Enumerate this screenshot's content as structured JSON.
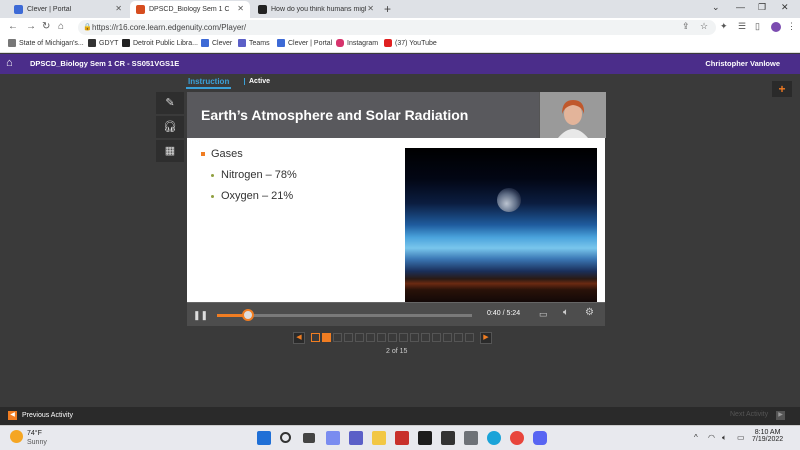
{
  "browser": {
    "tabs": [
      {
        "label": "Clever | Portal",
        "color": "#3d6ad6",
        "active": false
      },
      {
        "label": "DPSCD_Biology Sem 1 CR - Edgenuity",
        "color": "#d64d1f",
        "active": true
      },
      {
        "label": "How do you think humans might",
        "color": "#222222",
        "active": false
      }
    ],
    "url": "https://r16.core.learn.edgenuity.com/Player/",
    "bookmarks": [
      {
        "label": "State of Michigan's...",
        "color": "#777777"
      },
      {
        "label": "GDYT",
        "color": "#333333"
      },
      {
        "label": "Detroit Public Libra...",
        "color": "#222222"
      },
      {
        "label": "Clever",
        "color": "#3d6ad6"
      },
      {
        "label": "Teams",
        "color": "#5b5fc7"
      },
      {
        "label": "Clever | Portal",
        "color": "#3d6ad6"
      },
      {
        "label": "Instagram",
        "color": "#d6336c"
      },
      {
        "label": "(37) YouTube",
        "color": "#e02020"
      }
    ]
  },
  "app": {
    "course_title": "DPSCD_Biology Sem 1 CR - SS051VGS1E",
    "user_name": "Christopher Vanlowe",
    "subtabs": {
      "instruction": "Instruction",
      "active": "Active"
    }
  },
  "slide": {
    "title": "Earth’s Atmosphere and Solar Radiation",
    "bullet_main": "Gases",
    "bullet_sub": [
      "Nitrogen – 78%",
      "Oxygen – 21%"
    ]
  },
  "player": {
    "time": "0:40 / 5:24",
    "progress": 0.123
  },
  "pager": {
    "total": 15,
    "current": 2,
    "label": "2 of 15"
  },
  "footer": {
    "prev_label": "Previous Activity",
    "next_label": "Next Activity"
  },
  "taskbar": {
    "temp": "74°F",
    "condition": "Sunny",
    "time": "8:10 AM",
    "date": "7/19/2022"
  }
}
